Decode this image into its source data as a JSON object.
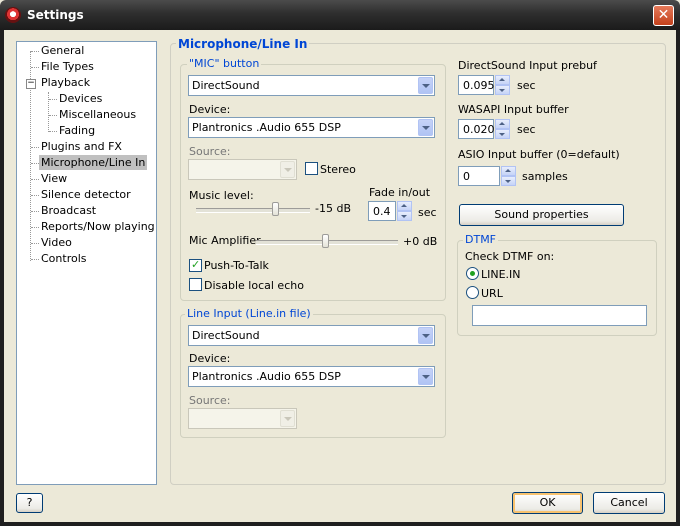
{
  "window": {
    "title": "Settings",
    "close_glyph": "✕",
    "icon": "app-settings-icon"
  },
  "tree": {
    "items": [
      {
        "label": "General"
      },
      {
        "label": "File Types"
      },
      {
        "label": "Playback",
        "expander": "−"
      },
      {
        "label": "Devices"
      },
      {
        "label": "Miscellaneous"
      },
      {
        "label": "Fading"
      },
      {
        "label": "Plugins and FX"
      },
      {
        "label": "Microphone/Line In",
        "selected": true
      },
      {
        "label": "View"
      },
      {
        "label": "Silence detector"
      },
      {
        "label": "Broadcast"
      },
      {
        "label": "Reports/Now playing"
      },
      {
        "label": "Video"
      },
      {
        "label": "Controls"
      }
    ]
  },
  "panel": {
    "title": "Microphone/Line In"
  },
  "mic": {
    "group_title": "\"MIC\" button",
    "driver_value": "DirectSound",
    "device_label": "Device:",
    "device_value": "Plantronics .Audio 655 DSP",
    "source_label": "Source:",
    "source_value": "",
    "stereo_label": "Stereo",
    "stereo_checked": false,
    "music_level_label": "Music level:",
    "music_level_value": "-15 dB",
    "music_level_fraction": 0.71,
    "fade_label": "Fade in/out",
    "fade_value": "0.4",
    "fade_unit": "sec",
    "mic_amp_label": "Mic Amplifier",
    "mic_amp_value": "+0 dB",
    "mic_amp_fraction": 0.49,
    "push_to_talk_label": "Push-To-Talk",
    "push_to_talk_checked": true,
    "disable_echo_label": "Disable local echo",
    "disable_echo_checked": false
  },
  "line": {
    "group_title": "Line Input (Line.in file)",
    "driver_value": "DirectSound",
    "device_label": "Device:",
    "device_value": "Plantronics .Audio 655 DSP",
    "source_label": "Source:",
    "source_value": ""
  },
  "buffers": {
    "ds_label": "DirectSound Input prebuf",
    "ds_value": "0.095",
    "ds_unit": "sec",
    "wasapi_label": "WASAPI Input buffer",
    "wasapi_value": "0.020",
    "wasapi_unit": "sec",
    "asio_label": "ASIO Input buffer (0=default)",
    "asio_value": "0",
    "asio_unit": "samples"
  },
  "sound_properties_label": "Sound properties",
  "dtmf": {
    "group_title": "DTMF",
    "check_label": "Check DTMF on:",
    "opt_line_label": "LINE.IN",
    "opt_url_label": "URL",
    "selected": "LINE.IN",
    "url_value": ""
  },
  "footer": {
    "help_label": "?",
    "ok_label": "OK",
    "cancel_label": "Cancel"
  }
}
